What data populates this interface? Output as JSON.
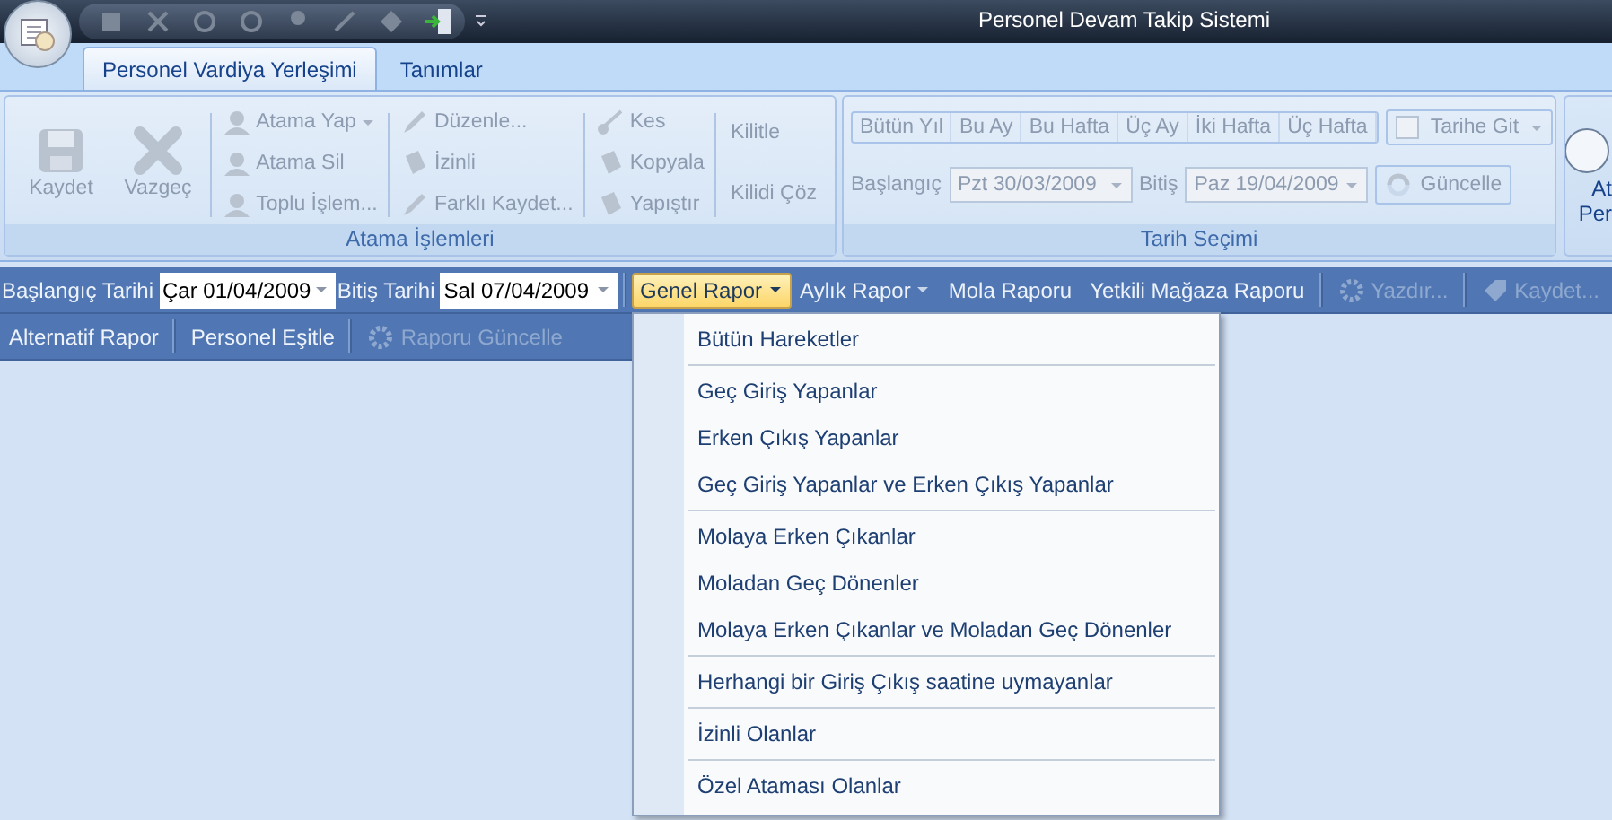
{
  "window": {
    "title": "Personel Devam Takip Sistemi"
  },
  "tabs": [
    {
      "label": "Personel Vardiya Yerleşimi",
      "selected": true
    },
    {
      "label": "Tanımlar",
      "selected": false
    }
  ],
  "ribbon": {
    "groups": [
      {
        "kind": "commands",
        "label": "Atama İşlemleri",
        "columns": [
          {
            "kind": "large",
            "items": [
              {
                "label": "Kaydet",
                "disabled": true
              }
            ]
          },
          {
            "kind": "large",
            "items": [
              {
                "label": "Vazgeç",
                "disabled": true
              }
            ]
          },
          {
            "kind": "small",
            "items": [
              {
                "label": "Atama Yap",
                "disabled": true,
                "dropdown": true
              },
              {
                "label": "Atama Sil",
                "disabled": true
              },
              {
                "label": "Toplu İşlem...",
                "disabled": true
              }
            ]
          },
          {
            "kind": "small",
            "items": [
              {
                "label": "Düzenle...",
                "disabled": true
              },
              {
                "label": "İzinli",
                "disabled": true
              },
              {
                "label": "Farklı Kaydet...",
                "disabled": true
              }
            ]
          },
          {
            "kind": "small",
            "items": [
              {
                "label": "Kes",
                "disabled": true
              },
              {
                "label": "Kopyala",
                "disabled": true
              },
              {
                "label": "Yapıştır",
                "disabled": true
              }
            ]
          },
          {
            "kind": "text",
            "items": [
              {
                "label": "Kilitle",
                "disabled": true
              },
              {
                "label": "Kilidi Çöz",
                "disabled": true
              }
            ]
          }
        ]
      },
      {
        "kind": "dates",
        "label": "Tarih Seçimi",
        "ranges": [
          {
            "label": "Bütün Yıl",
            "disabled": true
          },
          {
            "label": "Bu Ay",
            "disabled": true
          },
          {
            "label": "Bu Hafta",
            "disabled": true
          },
          {
            "label": "Üç Ay",
            "disabled": true
          },
          {
            "label": "İki Hafta",
            "disabled": true
          },
          {
            "label": "Üç Hafta",
            "disabled": true
          }
        ],
        "goto": {
          "label": "Tarihe Git",
          "disabled": true
        },
        "start": {
          "label": "Başlangıç",
          "value": "Pzt 30/03/2009",
          "disabled": true
        },
        "end": {
          "label": "Bitiş",
          "value": "Paz 19/04/2009",
          "disabled": true
        },
        "refresh": {
          "label": "Güncelle",
          "disabled": true
        }
      },
      {
        "kind": "partial",
        "lines": [
          "At",
          "Per"
        ]
      }
    ]
  },
  "toolbar_1": [
    {
      "kind": "label",
      "label": "Başlangıç Tarihi"
    },
    {
      "kind": "date",
      "value": "Çar 01/04/2009"
    },
    {
      "kind": "label",
      "label": "Bitiş Tarihi"
    },
    {
      "kind": "date",
      "value": "Sal 07/04/2009"
    },
    {
      "kind": "separator"
    },
    {
      "kind": "button",
      "label": "Genel Rapor",
      "dropdown": true,
      "selected": true,
      "disabled": false
    },
    {
      "kind": "button",
      "label": "Aylık Rapor",
      "dropdown": true,
      "selected": false,
      "disabled": false
    },
    {
      "kind": "button",
      "label": "Mola Raporu",
      "selected": false,
      "disabled": false
    },
    {
      "kind": "button",
      "label": "Yetkili Mağaza Raporu",
      "selected": false,
      "disabled": false
    },
    {
      "kind": "separator"
    },
    {
      "kind": "icon_button",
      "label": "Yazdır...",
      "selected": false,
      "disabled": true
    },
    {
      "kind": "separator"
    },
    {
      "kind": "icon_button",
      "label": "Kaydet...",
      "selected": false,
      "disabled": true
    }
  ],
  "toolbar_2": [
    {
      "kind": "button",
      "label": "Alternatif Rapor",
      "selected": false,
      "disabled": false
    },
    {
      "kind": "separator"
    },
    {
      "kind": "button",
      "label": "Personel Eşitle",
      "selected": false,
      "disabled": false
    },
    {
      "kind": "separator"
    },
    {
      "kind": "icon_button",
      "label": "Raporu Güncelle",
      "selected": false,
      "disabled": true
    }
  ],
  "menu": {
    "groups": [
      [
        "Bütün Hareketler"
      ],
      [
        "Geç Giriş Yapanlar",
        "Erken Çıkış Yapanlar",
        "Geç Giriş Yapanlar ve Erken Çıkış Yapanlar"
      ],
      [
        "Molaya Erken Çıkanlar",
        "Moladan Geç Dönenler",
        "Molaya Erken Çıkanlar ve Moladan Geç Dönenler"
      ],
      [
        "Herhangi bir Giriş Çıkış saatine uymayanlar"
      ],
      [
        "İzinli Olanlar"
      ],
      [
        "Özel Ataması Olanlar"
      ]
    ]
  }
}
